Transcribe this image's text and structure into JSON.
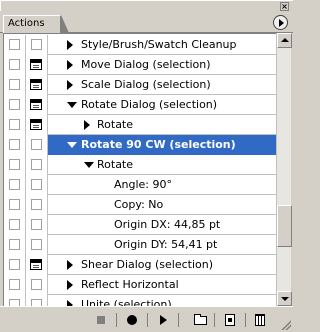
{
  "panel": {
    "tab_label": "Actions",
    "close_glyph": "×"
  },
  "rows": [
    {
      "label": "Style/Brush/Swatch Cleanup",
      "expander": "collapsed",
      "dialog": false,
      "indent": 0
    },
    {
      "label": "Move Dialog (selection)",
      "expander": "collapsed",
      "dialog": true,
      "indent": 0
    },
    {
      "label": "Scale Dialog (selection)",
      "expander": "collapsed",
      "dialog": true,
      "indent": 0
    },
    {
      "label": "Rotate Dialog (selection)",
      "expander": "expanded",
      "dialog": true,
      "indent": 0
    },
    {
      "label": "Rotate",
      "expander": "collapsed",
      "dialog": true,
      "indent": 1
    },
    {
      "label": "Rotate 90 CW (selection)",
      "expander": "expanded",
      "dialog": false,
      "indent": 0,
      "selected": true
    },
    {
      "label": "Rotate",
      "expander": "expanded",
      "dialog": false,
      "indent": 1
    },
    {
      "label": "Angle: 90°",
      "expander": "none",
      "dialog": false,
      "indent": 2
    },
    {
      "label": "Copy: No",
      "expander": "none",
      "dialog": false,
      "indent": 2
    },
    {
      "label": "Origin DX: 44,85 pt",
      "expander": "none",
      "dialog": false,
      "indent": 2
    },
    {
      "label": "Origin DY: 54,41 pt",
      "expander": "none",
      "dialog": false,
      "indent": 2
    },
    {
      "label": "Shear Dialog (selection)",
      "expander": "collapsed",
      "dialog": true,
      "indent": 0
    },
    {
      "label": "Reflect Horizontal",
      "expander": "collapsed",
      "dialog": false,
      "indent": 0
    },
    {
      "label": "Unite (selection)",
      "expander": "collapsed",
      "dialog": false,
      "indent": 0
    }
  ],
  "toolbar": {
    "buttons": [
      "stop-icon",
      "record-icon",
      "play-icon",
      "new-set-folder-icon",
      "new-action-icon",
      "trash-icon"
    ]
  },
  "colors": {
    "selection": "#316ac5",
    "panel_bg": "#d4d0c8"
  }
}
